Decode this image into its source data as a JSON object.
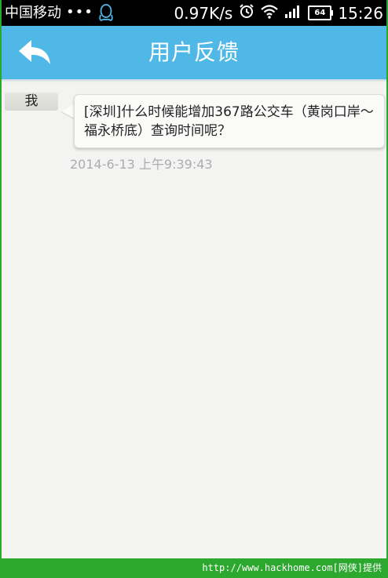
{
  "status_bar": {
    "carrier": "中国移动",
    "dots": "•••",
    "net_speed": "0.97K/s",
    "battery": "64",
    "time": "15:26"
  },
  "header": {
    "title": "用户反馈"
  },
  "chat": {
    "messages": [
      {
        "sender": "我",
        "text": "[深圳]什么时候能增加367路公交车（黄岗口岸～福永桥底）查询时间呢？",
        "time": "2014-6-13 上午9:39:43"
      }
    ]
  },
  "footer": {
    "watermark": "http://www.hackhome.com[网侠]提供"
  },
  "colors": {
    "title_bar": "#4fb8e7",
    "chat_background": "#f3f3f1",
    "footer": "#2ca82f"
  }
}
